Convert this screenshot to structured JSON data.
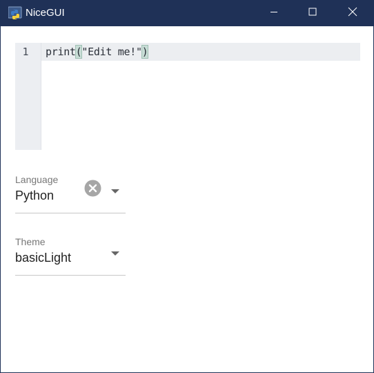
{
  "window": {
    "title": "NiceGUI",
    "icon": "python-icon",
    "controls": [
      "minimize-icon",
      "maximize-icon",
      "close-icon"
    ]
  },
  "editor": {
    "line_number": "1",
    "code_before": "print",
    "code_open_paren": "(",
    "code_string": "\"Edit me!\"",
    "code_close_paren": ")"
  },
  "language_select": {
    "label": "Language",
    "value": "Python",
    "clear_icon": "clear-circle-icon",
    "arrow_icon": "chevron-down-icon"
  },
  "theme_select": {
    "label": "Theme",
    "value": "basicLight",
    "arrow_icon": "chevron-down-icon"
  },
  "colors": {
    "titlebar": "#1f3157",
    "gutter": "#eceef2",
    "active_line": "#eceef1",
    "bracket_match": "#c8ddd6"
  }
}
